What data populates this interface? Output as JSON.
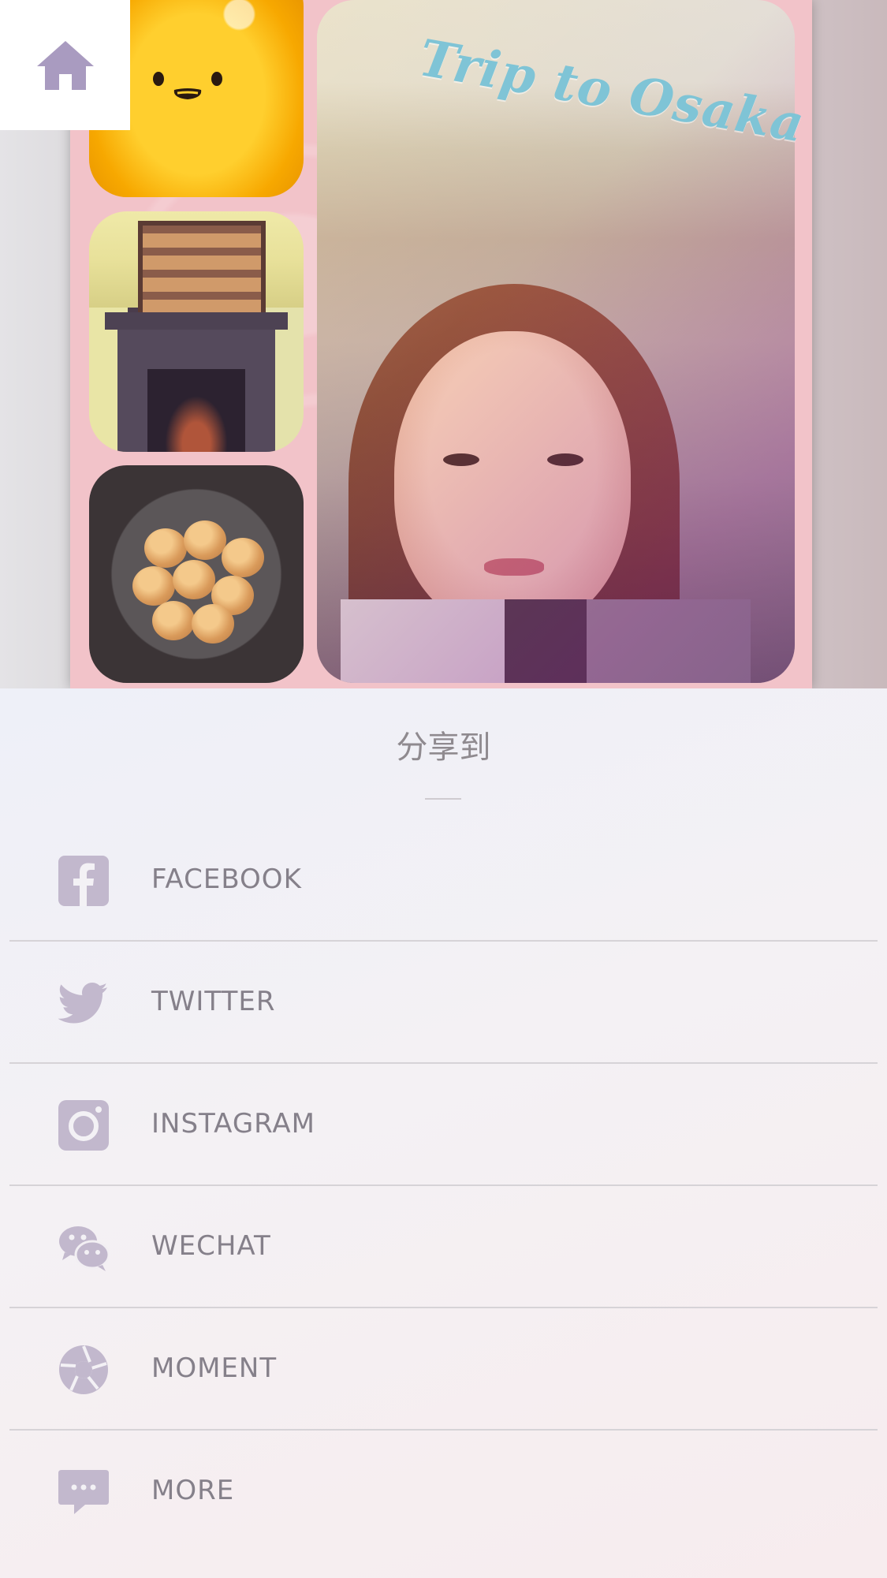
{
  "collage": {
    "title": "Trip to Osaka"
  },
  "home_button": {
    "icon": "home-icon",
    "color": "#a99bc0"
  },
  "share_sheet": {
    "title": "分享到",
    "icon_color": "#c2b8cd",
    "items": [
      {
        "label": "FACEBOOK",
        "icon": "facebook-icon"
      },
      {
        "label": "TWITTER",
        "icon": "twitter-icon"
      },
      {
        "label": "INSTAGRAM",
        "icon": "instagram-icon"
      },
      {
        "label": "WECHAT",
        "icon": "wechat-icon"
      },
      {
        "label": "MOMENT",
        "icon": "moment-icon"
      },
      {
        "label": "MORE",
        "icon": "more-icon"
      }
    ]
  }
}
